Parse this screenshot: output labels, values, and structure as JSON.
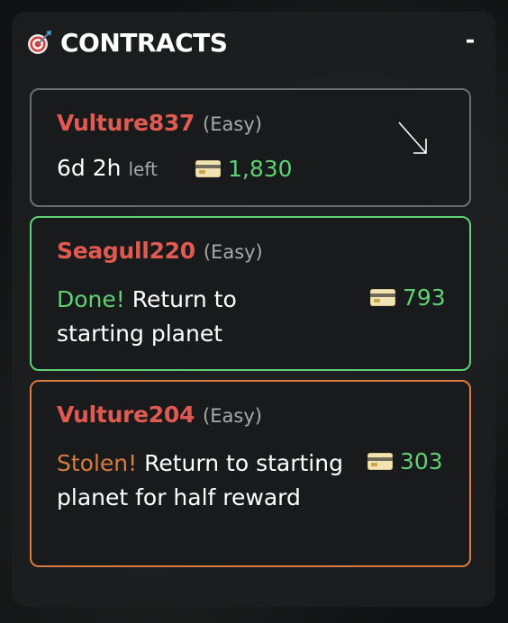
{
  "panel": {
    "title": "CONTRACTS",
    "collapse_label": "-",
    "icon": "target-icon"
  },
  "contracts": [
    {
      "target": "Vulture837",
      "difficulty": "(Easy)",
      "time_value": "6d 2h",
      "time_suffix": "left",
      "reward": "1,830",
      "direction_icon": "arrow-down-right-icon",
      "state": "active"
    },
    {
      "target": "Seagull220",
      "difficulty": "(Easy)",
      "status_label": "Done!",
      "status_message": "Return to starting planet",
      "reward": "793",
      "state": "done"
    },
    {
      "target": "Vulture204",
      "difficulty": "(Easy)",
      "status_label": "Stolen!",
      "status_message": "Return to starting planet for half reward",
      "reward": "303",
      "state": "stolen"
    }
  ],
  "colors": {
    "target_name": "#e05a52",
    "reward": "#5fd174",
    "done": "#5fd174",
    "stolen": "#d77b3f",
    "muted": "#a7a9aa"
  }
}
